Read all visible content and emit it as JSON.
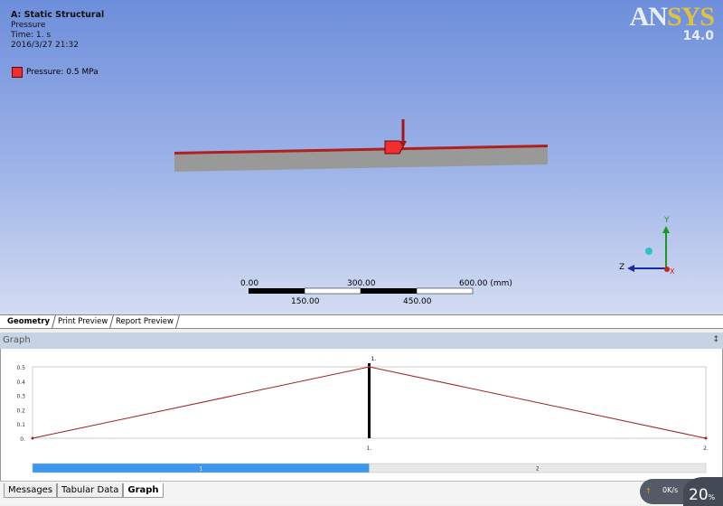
{
  "viewport": {
    "title": "A: Static Structural",
    "subtitle": "Pressure",
    "time": "Time: 1. s",
    "date": "2016/3/27 21:32",
    "legend": "Pressure: 0.5 MPa",
    "legend_color": "#f03030",
    "logo_a": "AN",
    "logo_b": "SYS",
    "version": "14.0",
    "scale": {
      "top": [
        "0.00",
        "300.00",
        "600.00 (mm)"
      ],
      "bottom": [
        "150.00",
        "450.00"
      ]
    },
    "axes": {
      "x": "X",
      "y": "Y",
      "z": "Z"
    }
  },
  "tabs": [
    "Geometry",
    "Print Preview",
    "Report Preview"
  ],
  "graph_header": "Graph",
  "pin": "↕",
  "chart_data": {
    "type": "line",
    "x": [
      0,
      1,
      2
    ],
    "values": [
      0,
      0.5,
      0
    ],
    "xticks": [
      "1.",
      "2."
    ],
    "yticks": [
      "0.",
      "0.1",
      "0.2",
      "0.3",
      "0.4",
      "0.5"
    ],
    "ylim": [
      0,
      0.5
    ],
    "xlim": [
      0,
      2
    ],
    "marker_label": "1.",
    "color": "#a02020",
    "steps": [
      "1",
      "2"
    ],
    "step_color": "#3b98ee"
  },
  "bottom_tabs": [
    "Messages",
    "Tabular Data",
    "Graph"
  ],
  "net": {
    "rate": "0K/s",
    "percent": "20",
    "unit": "%"
  }
}
